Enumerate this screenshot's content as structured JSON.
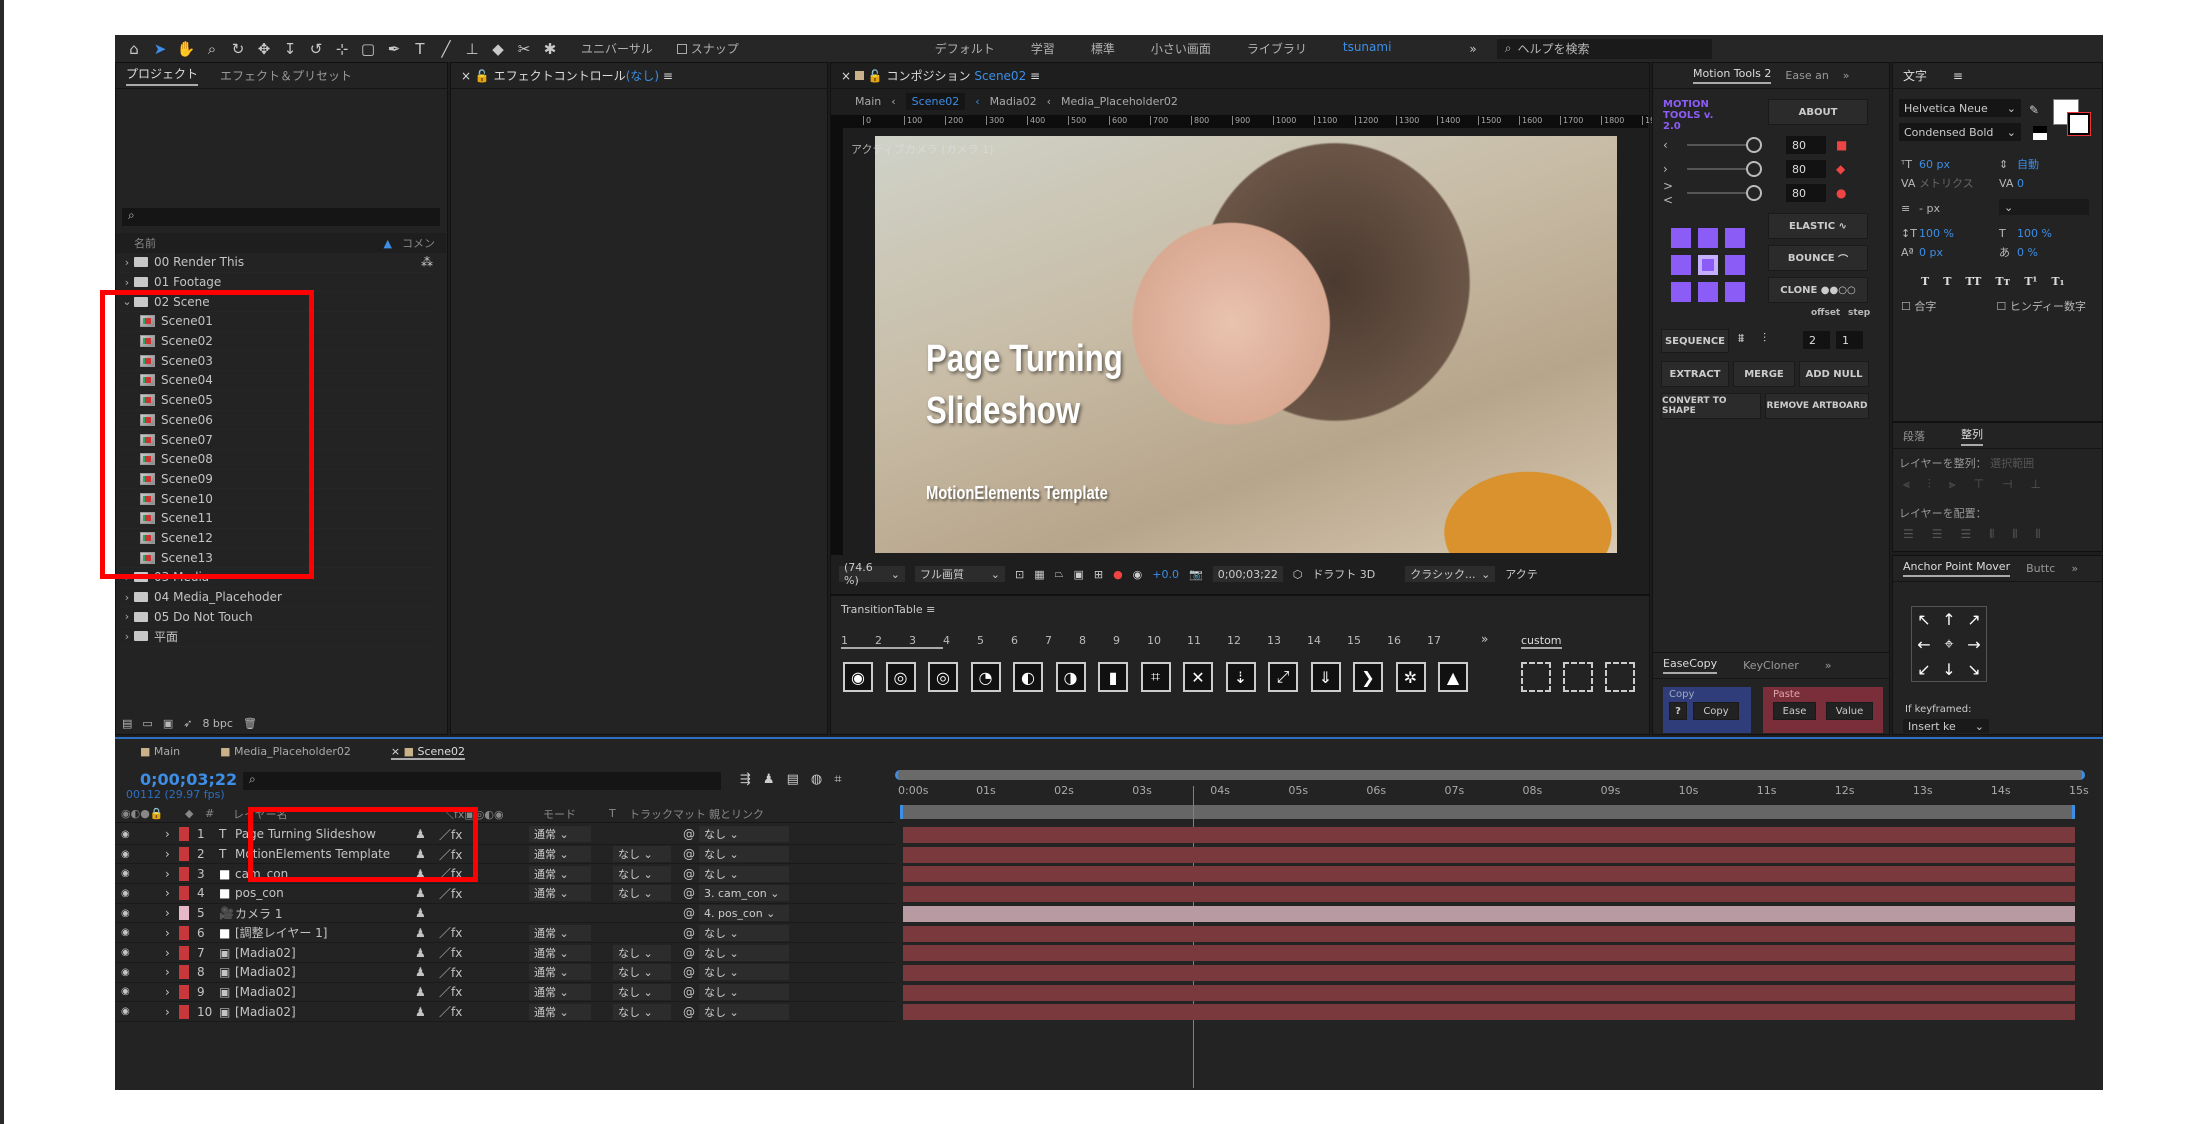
{
  "toolbar": {
    "tools": [
      "home-icon",
      "selection-icon",
      "hand-icon",
      "zoom-icon",
      "orbit-icon",
      "pan-icon",
      "dolly-icon",
      "rotate-icon",
      "anchor-icon",
      "rectangle-icon",
      "pen-icon",
      "type-icon",
      "brush-icon",
      "stamp-icon",
      "eraser-icon",
      "roto-icon",
      "puppet-icon"
    ],
    "universal": "ユニバーサル",
    "snap": "スナップ",
    "workspaces": [
      "デフォルト",
      "学習",
      "標準",
      "小さい画面",
      "ライブラリ",
      "tsunami"
    ],
    "active_workspace": "tsunami",
    "help_placeholder": "ヘルプを検索"
  },
  "project": {
    "tabs": [
      "プロジェクト",
      "エフェクト＆プリセット"
    ],
    "col_name": "名前",
    "col_comment": "コメン",
    "items": [
      {
        "label": "00 Render This",
        "type": "folder",
        "open": false,
        "indent": 0
      },
      {
        "label": "01 Footage",
        "type": "folder",
        "open": false,
        "indent": 0
      },
      {
        "label": "02 Scene",
        "type": "folder",
        "open": true,
        "indent": 0
      },
      {
        "label": "Scene01",
        "type": "comp",
        "indent": 1
      },
      {
        "label": "Scene02",
        "type": "comp",
        "indent": 1
      },
      {
        "label": "Scene03",
        "type": "comp",
        "indent": 1
      },
      {
        "label": "Scene04",
        "type": "comp",
        "indent": 1
      },
      {
        "label": "Scene05",
        "type": "comp",
        "indent": 1
      },
      {
        "label": "Scene06",
        "type": "comp",
        "indent": 1
      },
      {
        "label": "Scene07",
        "type": "comp",
        "indent": 1
      },
      {
        "label": "Scene08",
        "type": "comp",
        "indent": 1
      },
      {
        "label": "Scene09",
        "type": "comp",
        "indent": 1
      },
      {
        "label": "Scene10",
        "type": "comp",
        "indent": 1
      },
      {
        "label": "Scene11",
        "type": "comp",
        "indent": 1
      },
      {
        "label": "Scene12",
        "type": "comp",
        "indent": 1
      },
      {
        "label": "Scene13",
        "type": "comp",
        "indent": 1
      },
      {
        "label": "03 Media",
        "type": "folder",
        "open": false,
        "indent": 0
      },
      {
        "label": "04 Media_Placehoder",
        "type": "folder",
        "open": false,
        "indent": 0
      },
      {
        "label": "05 Do Not Touch",
        "type": "folder",
        "open": false,
        "indent": 0
      },
      {
        "label": "平面",
        "type": "folder",
        "open": false,
        "indent": 0
      }
    ],
    "bpc": "8 bpc"
  },
  "effects": {
    "title": "エフェクトコントロール",
    "value": "(なし)"
  },
  "composition": {
    "title": "コンポジション",
    "comp": "Scene02",
    "breadcrumbs": [
      "Main",
      "Scene02",
      "Madia02",
      "Media_Placeholder02"
    ],
    "ruler": [
      "0",
      "100",
      "200",
      "300",
      "400",
      "500",
      "600",
      "700",
      "800",
      "900",
      "1000",
      "1100",
      "1200",
      "1300",
      "1400",
      "1500",
      "1600",
      "1700",
      "1800",
      "1900"
    ],
    "camera_label": "アクティブカメラ (カメラ 1)",
    "overlay_title": "Page Turning Slideshow",
    "overlay_sub": "MotionElements Template",
    "zoom": "(74.6 %)",
    "quality": "フル画質",
    "exposure": "+0.0",
    "timecode": "0;00;03;22",
    "renderer": "ドラフト 3D",
    "view": "クラシック...",
    "camera_view": "アクテ"
  },
  "transition_table": {
    "title": "TransitionTable",
    "pages": [
      "1",
      "2",
      "3",
      "4",
      "5",
      "6",
      "7",
      "8",
      "9",
      "10",
      "11",
      "12",
      "13",
      "14",
      "15",
      "16",
      "17"
    ],
    "custom": "custom",
    "icons": [
      "◉",
      "◎",
      "◎",
      "◔",
      "◐",
      "◑",
      "▮",
      "⌗",
      "✕",
      "⇣",
      "⤢",
      "⇓",
      "❯",
      "✲",
      "▲"
    ]
  },
  "motion_tools": {
    "tabs": [
      "Motion Tools 2",
      "Ease an"
    ],
    "logo": "MOTION TOOLS v. 2.0",
    "about": "ABOUT",
    "sliders": [
      {
        "icon": "‹",
        "value": "80"
      },
      {
        "icon": "›",
        "value": "80"
      },
      {
        "icon": "><",
        "value": "80"
      }
    ],
    "elastic": "ELASTIC",
    "bounce": "BOUNCE",
    "clone": "CLONE",
    "offset_label": "offset",
    "step_label": "step",
    "offset": "2",
    "step": "1",
    "sequence": "SEQUENCE",
    "extract": "EXTRACT",
    "merge": "MERGE",
    "add_null": "ADD NULL",
    "convert": "CONVERT TO SHAPE",
    "remove": "REMOVE ARTBOARD",
    "accent": "#8b5cf6"
  },
  "character": {
    "title": "文字",
    "font": "Helvetica Neue",
    "style": "Condensed Bold",
    "size": "60 px",
    "leading": "自動",
    "kerning": "メトリクス",
    "tracking": "0",
    "stroke": "- px",
    "vscale": "100 %",
    "hscale": "100 %",
    "baseline": "0 px",
    "tsume": "0 %",
    "styles": [
      "T",
      "T",
      "TT",
      "Tт",
      "T¹",
      "T₁"
    ],
    "ligature": "合字",
    "hindi": "ヒンディー数字"
  },
  "align": {
    "tabs": [
      "段落",
      "整列"
    ],
    "align_to": "レイヤーを整列：",
    "align_sel": "選択範囲",
    "distribute": "レイヤーを配置："
  },
  "anchor": {
    "tabs": [
      "Anchor Point Mover",
      "Buttc"
    ],
    "arrows": [
      "↖",
      "↑",
      "↗",
      "←",
      "⌖",
      "→",
      "↙",
      "↓",
      "↘"
    ],
    "if_key": "If keyframed:",
    "insert": "Insert ke"
  },
  "easecopy": {
    "tabs": [
      "EaseCopy",
      "KeyCloner"
    ],
    "copy_title": "Copy",
    "help": "?",
    "copy": "Copy",
    "paste_title": "Paste",
    "ease": "Ease",
    "value": "Value"
  },
  "timeline": {
    "tabs": [
      "Main",
      "Media_Placeholder02",
      "Scene02"
    ],
    "timecode": "0;00;03;22",
    "frames": "00112 (29.97 fps)",
    "cols": {
      "num": "#",
      "name": "レイヤー名",
      "mode": "モード",
      "t": "T",
      "matte": "トラックマット",
      "parent": "親とリンク"
    },
    "ruler": [
      "0:00s",
      "01s",
      "02s",
      "03s",
      "04s",
      "05s",
      "06s",
      "07s",
      "08s",
      "09s",
      "10s",
      "11s",
      "12s",
      "13s",
      "14s",
      "15s"
    ],
    "playhead_seconds": 3.73,
    "duration_seconds": 15,
    "layers": [
      {
        "n": "1",
        "type": "text",
        "name": "Page Turning Slideshow",
        "mode": "通常",
        "matte": "",
        "parent": "なし",
        "color": "#c8373b"
      },
      {
        "n": "2",
        "type": "text",
        "name": "MotionElements Template",
        "mode": "通常",
        "matte": "なし",
        "parent": "なし",
        "color": "#c8373b"
      },
      {
        "n": "3",
        "type": "solid",
        "name": "cam_con",
        "mode": "通常",
        "matte": "なし",
        "parent": "なし",
        "color": "#c8373b"
      },
      {
        "n": "4",
        "type": "solid",
        "name": "pos_con",
        "mode": "通常",
        "matte": "なし",
        "parent": "3. cam_con",
        "color": "#c8373b"
      },
      {
        "n": "5",
        "type": "camera",
        "name": "カメラ 1",
        "mode": "",
        "matte": "",
        "parent": "4. pos_con",
        "color": "#e8b8c8"
      },
      {
        "n": "6",
        "type": "solid",
        "name": "[調整レイヤー 1]",
        "mode": "通常",
        "matte": "",
        "parent": "なし",
        "color": "#c8373b"
      },
      {
        "n": "7",
        "type": "comp",
        "name": "[Madia02]",
        "mode": "通常",
        "matte": "なし",
        "parent": "なし",
        "color": "#c8373b"
      },
      {
        "n": "8",
        "type": "comp",
        "name": "[Madia02]",
        "mode": "通常",
        "matte": "なし",
        "parent": "なし",
        "color": "#c8373b"
      },
      {
        "n": "9",
        "type": "comp",
        "name": "[Madia02]",
        "mode": "通常",
        "matte": "なし",
        "parent": "なし",
        "color": "#c8373b"
      },
      {
        "n": "10",
        "type": "comp",
        "name": "[Madia02]",
        "mode": "通常",
        "matte": "なし",
        "parent": "なし",
        "color": "#c8373b"
      }
    ]
  },
  "colors": {
    "accent": "#3d8ee6",
    "highlight": "#ff0000",
    "layer_bar": "#7a3a3d",
    "camera_bar": "#b89aa2"
  }
}
